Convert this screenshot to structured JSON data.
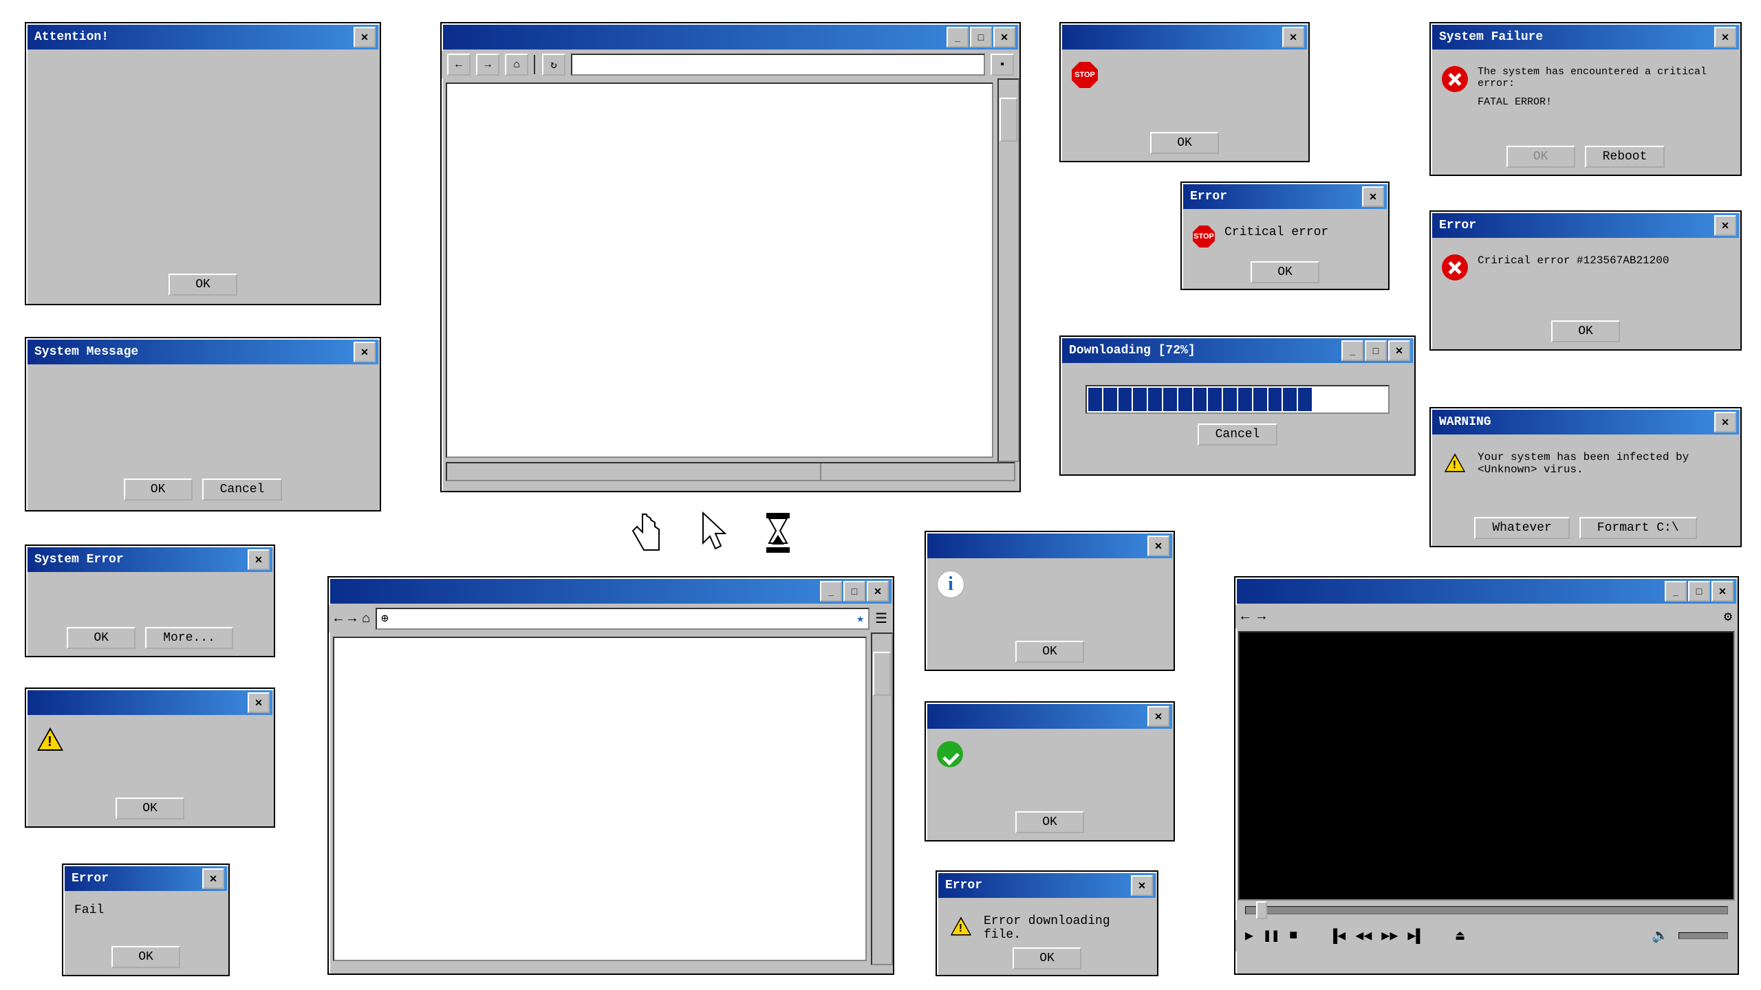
{
  "common": {
    "ok": "OK",
    "cancel": "Cancel"
  },
  "w1": {
    "title": "Attention!"
  },
  "w2": {
    "title": "System Message"
  },
  "w3": {
    "title": "System Error",
    "more": "More..."
  },
  "w4": {
    "title": ""
  },
  "w5": {
    "title": "Error",
    "msg": "Fail"
  },
  "w6": {
    "title": ""
  },
  "w7": {
    "title": ""
  },
  "w8": {
    "title": "",
    "stop": "STOP"
  },
  "w9": {
    "title": "Error",
    "msg": "Critical error"
  },
  "w10": {
    "title": "Downloading [72%]",
    "progress": 72,
    "segments": 20,
    "filled": 15
  },
  "w11": {
    "title": ""
  },
  "w12": {
    "title": ""
  },
  "w13": {
    "title": "Error",
    "msg": "Error downloading file."
  },
  "w14": {
    "title": "System Failure",
    "msg1": "The system has encountered a critical error:",
    "msg2": "FATAL ERROR!",
    "reboot": "Reboot"
  },
  "w15": {
    "title": "Error",
    "msg": "Crirical error #123567AB21200"
  },
  "w16": {
    "title": "WARNING",
    "msg": "Your system has been infected by <Unknown> virus.",
    "b1": "Whatever",
    "b2": "Formart C:\\"
  },
  "w17": {
    "title": ""
  },
  "cursors": {
    "hand": "hand-cursor",
    "arrow": "arrow-cursor",
    "hourglass": "hourglass-cursor"
  }
}
